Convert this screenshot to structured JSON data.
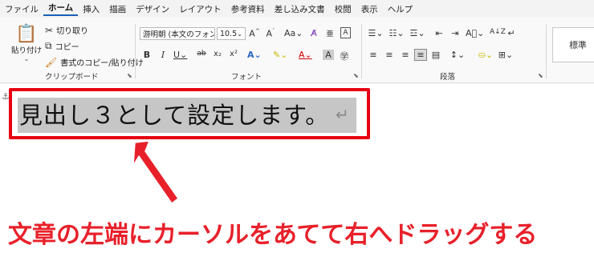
{
  "menu": {
    "tabs": [
      "ファイル",
      "ホーム",
      "挿入",
      "描画",
      "デザイン",
      "レイアウト",
      "参考資料",
      "差し込み文書",
      "校閲",
      "表示",
      "ヘルプ"
    ],
    "active_index": 1
  },
  "ribbon": {
    "clipboard": {
      "paste_label": "貼り付け",
      "cut_label": "切り取り",
      "copy_label": "コピー",
      "format_painter_label": "書式のコピー/貼り付け",
      "group_label": "クリップボード"
    },
    "font": {
      "font_name": "游明朝 (本文のフォン",
      "font_size": "10.5",
      "group_label": "フォント"
    },
    "paragraph": {
      "group_label": "段落"
    },
    "styles": {
      "first_style": "標準"
    }
  },
  "document": {
    "heading_text": "見出し３として設定します。",
    "paragraph_mark": "↵"
  },
  "annotation": {
    "caption": "文章の左端にカーソルをあてて右へドラッグする",
    "accent_color": "#e60012"
  }
}
